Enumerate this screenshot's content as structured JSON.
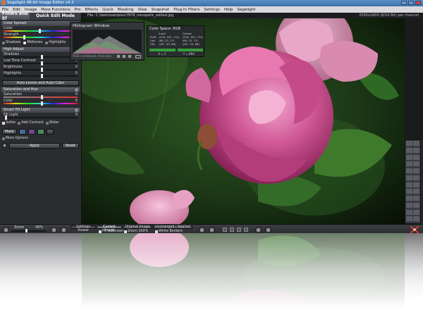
{
  "window": {
    "title": "Segelight 48-bit Image Editor v4.3"
  },
  "menu": [
    "File",
    "Edit",
    "Image",
    "More Functions",
    "Pro",
    "Effects",
    "Quick",
    "Masking",
    "View",
    "Snapshot",
    "Plug-In Filters",
    "Settings",
    "Help",
    "Segelight"
  ],
  "file": {
    "path": "File: C:\\tests\\samples\\7878_nocopatic_edited.jpg",
    "dimensions": "2560x1600 (8/16 Bit) per channel"
  },
  "left_panel": {
    "title_a": "Filters and Ef",
    "title_b": "Quick Edit Mode",
    "color_spread": {
      "header": "Color Spread",
      "rows": [
        {
          "label": "Color",
          "value": ""
        },
        {
          "label": "Strength",
          "value": "0"
        }
      ]
    },
    "tone_radios": [
      {
        "label": "Shadows",
        "selected": false
      },
      {
        "label": "Midtones",
        "selected": true
      },
      {
        "label": "Highlights",
        "selected": false
      }
    ],
    "high_adjust": {
      "header": "High Adjust",
      "rows": [
        {
          "label": "Shadows",
          "value": "0"
        },
        {
          "label": "Low Tone Contrast",
          "value": "0"
        },
        {
          "label": "Brightness",
          "value": "0"
        },
        {
          "label": "Highlights",
          "value": "0"
        }
      ]
    },
    "auto_label": "Auto Levels and Auto Color",
    "saturation": {
      "header": "Saturation and Hue",
      "rows": [
        {
          "label": "Saturation",
          "value": "0"
        },
        {
          "label": "Color",
          "value": "0"
        }
      ]
    },
    "smart_fill": {
      "header": "Smart Fill Light",
      "rows": [
        {
          "label": "Fill Light",
          "value": "0"
        }
      ]
    },
    "checks": [
      "Softer",
      "Add Contrast",
      "Wider"
    ],
    "mask_label": "Mask",
    "more_options": "More Options",
    "apply_label": "Apply",
    "reset_label": "Reset"
  },
  "histogram": {
    "title": "Histogram Window",
    "footer": "RGB combined channels"
  },
  "color_space": {
    "title": "Color Space: RGB",
    "headers": [
      "",
      "Input",
      "Output"
    ],
    "rows": [
      [
        "RGB",
        "(218, 167, 131)",
        "(218, 167, 131)"
      ],
      [
        "Lab",
        "(69, 22, 27)",
        "(69, 22, 27)"
      ],
      [
        "HSL",
        "(26°, 53, 68)",
        "(26°, 53, 68)"
      ]
    ],
    "footer": [
      "X = 2",
      "Y = 864"
    ]
  },
  "bottom": {
    "zoom_label": "Zoom",
    "zoom_value": "49%",
    "tabs": [
      {
        "label": "Settings Viewer",
        "active": false
      },
      {
        "label": "Current Image",
        "active": true
      },
      {
        "label": "Original Image",
        "active": false
      },
      {
        "label": "Unchanged / Applied",
        "active": false
      }
    ],
    "options": [
      "Fit to Screen",
      "Zoom 100%",
      "White Borders"
    ]
  },
  "colors": {
    "accent_blue": "#3b6fa8",
    "panel": "#2b2c30",
    "progress_green": "#35a03a"
  }
}
